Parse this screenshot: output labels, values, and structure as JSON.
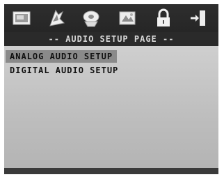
{
  "header": {
    "title": "-- AUDIO SETUP PAGE --"
  },
  "icons": [
    {
      "name": "general-setup-icon"
    },
    {
      "name": "audio-setup-icon",
      "active": true
    },
    {
      "name": "video-setup-icon"
    },
    {
      "name": "preference-icon"
    },
    {
      "name": "password-lock-icon"
    },
    {
      "name": "exit-icon"
    }
  ],
  "menu": {
    "items": [
      {
        "label": "ANALOG AUDIO SETUP",
        "selected": true
      },
      {
        "label": "DIGITAL AUDIO SETUP",
        "selected": false
      }
    ]
  },
  "colors": {
    "screen_background": "#2b2b2b",
    "panel_background": "#c4c4c4",
    "selection_highlight": "#8a8a8a"
  }
}
